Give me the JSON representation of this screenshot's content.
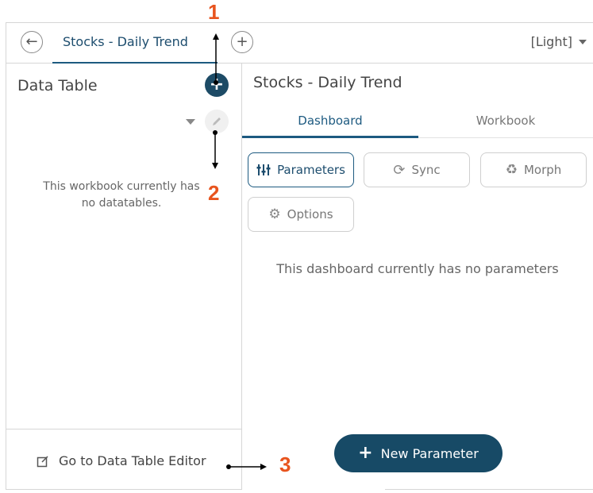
{
  "header": {
    "tab_label": "Stocks - Daily Trend",
    "theme_label": "[Light]"
  },
  "left_panel": {
    "title": "Data Table",
    "empty_message": "This workbook currently has no datatables.",
    "editor_link": "Go to Data Table Editor"
  },
  "right_panel": {
    "title": "Stocks - Daily Trend",
    "tabs": [
      {
        "label": "Dashboard",
        "active": true
      },
      {
        "label": "Workbook",
        "active": false
      }
    ],
    "buttons": {
      "parameters": "Parameters",
      "sync": "Sync",
      "morph": "Morph",
      "options": "Options"
    },
    "empty_message": "This dashboard currently has no parameters",
    "new_parameter": "New Parameter"
  },
  "annotations": {
    "one": "1",
    "two": "2",
    "three": "3"
  },
  "icons": [
    "back-arrow-icon",
    "add-tab-icon",
    "dropdown-caret-icon",
    "plus-icon",
    "pencil-icon",
    "sliders-icon",
    "sync-icon",
    "recycle-icon",
    "gear-icon",
    "external-edit-icon"
  ],
  "colors": {
    "accent": "#1d5a80",
    "fab": "#1d4b66",
    "annotation": "#e8541e"
  }
}
